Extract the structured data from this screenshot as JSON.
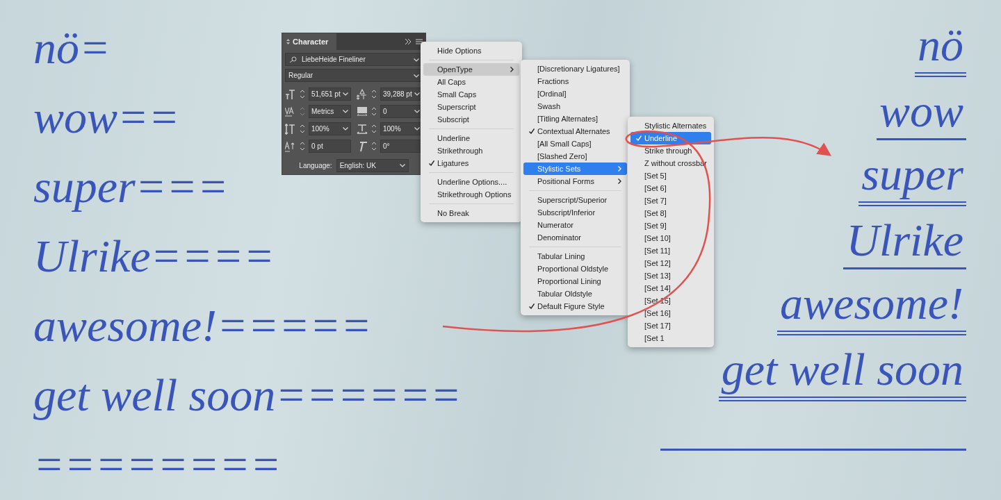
{
  "left_lines": [
    "nö=",
    "wow==",
    "super===",
    "Ulrike====",
    "awesome!=====",
    "get well soon======",
    "========"
  ],
  "right_lines": [
    {
      "text": "nö",
      "double_underline": true
    },
    {
      "text": "wow",
      "double_underline": false
    },
    {
      "text": "super",
      "double_underline": true
    },
    {
      "text": "Ulrike",
      "double_underline": false
    },
    {
      "text": "awesome!",
      "double_underline": true
    },
    {
      "text": "get well soon",
      "double_underline": true
    }
  ],
  "character_panel": {
    "title": "Character",
    "font": "LiebeHeide Fineliner",
    "style": "Regular",
    "fields": [
      {
        "value": "51,651 pt",
        "dropdown": true,
        "disabled": false
      },
      {
        "value": "39,288 pt",
        "dropdown": true,
        "disabled": false
      },
      {
        "value": "Metrics",
        "dropdown": true,
        "disabled": true
      },
      {
        "value": "0",
        "dropdown": true,
        "disabled": false
      },
      {
        "value": "100%",
        "dropdown": true,
        "disabled": false
      },
      {
        "value": "100%",
        "dropdown": true,
        "disabled": false
      },
      {
        "value": "0 pt",
        "dropdown": false,
        "disabled": false
      },
      {
        "value": "0°",
        "dropdown": false,
        "disabled": false
      }
    ],
    "language_label": "Language:",
    "language": "English: UK"
  },
  "menus": [
    {
      "focused": false,
      "groups": [
        [
          {
            "label": "Hide Options",
            "checked": false,
            "selected": false,
            "submenu": false
          }
        ],
        [
          {
            "label": "OpenType",
            "checked": false,
            "selected": true,
            "submenu": true
          },
          {
            "label": "All Caps",
            "checked": false,
            "selected": false,
            "submenu": false
          },
          {
            "label": "Small Caps",
            "checked": false,
            "selected": false,
            "submenu": false
          },
          {
            "label": "Superscript",
            "checked": false,
            "selected": false,
            "submenu": false
          },
          {
            "label": "Subscript",
            "checked": false,
            "selected": false,
            "submenu": false
          }
        ],
        [
          {
            "label": "Underline",
            "checked": false,
            "selected": false,
            "submenu": false
          },
          {
            "label": "Strikethrough",
            "checked": false,
            "selected": false,
            "submenu": false
          },
          {
            "label": "Ligatures",
            "checked": true,
            "selected": false,
            "submenu": false
          }
        ],
        [
          {
            "label": "Underline Options....",
            "checked": false,
            "selected": false,
            "submenu": false
          },
          {
            "label": "Strikethrough Options",
            "checked": false,
            "selected": false,
            "submenu": false
          }
        ],
        [
          {
            "label": "No Break",
            "checked": false,
            "selected": false,
            "submenu": false
          }
        ]
      ]
    },
    {
      "focused": true,
      "groups": [
        [
          {
            "label": "[Discretionary Ligatures]",
            "checked": false,
            "selected": false,
            "submenu": false
          },
          {
            "label": "Fractions",
            "checked": false,
            "selected": false,
            "submenu": false
          },
          {
            "label": "[Ordinal]",
            "checked": false,
            "selected": false,
            "submenu": false
          },
          {
            "label": "Swash",
            "checked": false,
            "selected": false,
            "submenu": false
          },
          {
            "label": "[Titling Alternates]",
            "checked": false,
            "selected": false,
            "submenu": false
          },
          {
            "label": "Contextual Alternates",
            "checked": true,
            "selected": false,
            "submenu": false
          },
          {
            "label": "[All Small Caps]",
            "checked": false,
            "selected": false,
            "submenu": false
          },
          {
            "label": "[Slashed Zero]",
            "checked": false,
            "selected": false,
            "submenu": false
          },
          {
            "label": "Stylistic Sets",
            "checked": false,
            "selected": true,
            "submenu": true
          },
          {
            "label": "Positional Forms",
            "checked": false,
            "selected": false,
            "submenu": true
          }
        ],
        [
          {
            "label": "Superscript/Superior",
            "checked": false,
            "selected": false,
            "submenu": false
          },
          {
            "label": "Subscript/Inferior",
            "checked": false,
            "selected": false,
            "submenu": false
          },
          {
            "label": "Numerator",
            "checked": false,
            "selected": false,
            "submenu": false
          },
          {
            "label": "Denominator",
            "checked": false,
            "selected": false,
            "submenu": false
          }
        ],
        [
          {
            "label": "Tabular Lining",
            "checked": false,
            "selected": false,
            "submenu": false
          },
          {
            "label": "Proportional Oldstyle",
            "checked": false,
            "selected": false,
            "submenu": false
          },
          {
            "label": "Proportional Lining",
            "checked": false,
            "selected": false,
            "submenu": false
          },
          {
            "label": "Tabular Oldstyle",
            "checked": false,
            "selected": false,
            "submenu": false
          },
          {
            "label": "Default Figure Style",
            "checked": true,
            "selected": false,
            "submenu": false
          }
        ]
      ]
    },
    {
      "focused": true,
      "groups": [
        [
          {
            "label": "Stylistic Alternates",
            "checked": false,
            "selected": false,
            "submenu": false
          },
          {
            "label": "Underline",
            "checked": true,
            "selected": true,
            "submenu": false
          },
          {
            "label": "Strike through",
            "checked": false,
            "selected": false,
            "submenu": false
          },
          {
            "label": "Z without crossbar",
            "checked": false,
            "selected": false,
            "submenu": false
          },
          {
            "label": "[Set 5]",
            "checked": false,
            "selected": false,
            "submenu": false
          },
          {
            "label": "[Set 6]",
            "checked": false,
            "selected": false,
            "submenu": false
          },
          {
            "label": "[Set 7]",
            "checked": false,
            "selected": false,
            "submenu": false
          },
          {
            "label": "[Set 8]",
            "checked": false,
            "selected": false,
            "submenu": false
          },
          {
            "label": "[Set 9]",
            "checked": false,
            "selected": false,
            "submenu": false
          },
          {
            "label": "[Set 10]",
            "checked": false,
            "selected": false,
            "submenu": false
          },
          {
            "label": "[Set 11]",
            "checked": false,
            "selected": false,
            "submenu": false
          },
          {
            "label": "[Set 12]",
            "checked": false,
            "selected": false,
            "submenu": false
          },
          {
            "label": "[Set 13]",
            "checked": false,
            "selected": false,
            "submenu": false
          },
          {
            "label": "[Set 14]",
            "checked": false,
            "selected": false,
            "submenu": false
          },
          {
            "label": "[Set 15]",
            "checked": false,
            "selected": false,
            "submenu": false
          },
          {
            "label": "[Set 16]",
            "checked": false,
            "selected": false,
            "submenu": false
          },
          {
            "label": "[Set 17]",
            "checked": false,
            "selected": false,
            "submenu": false
          },
          {
            "label": "[Set 1",
            "checked": false,
            "selected": false,
            "submenu": false
          }
        ]
      ]
    }
  ]
}
